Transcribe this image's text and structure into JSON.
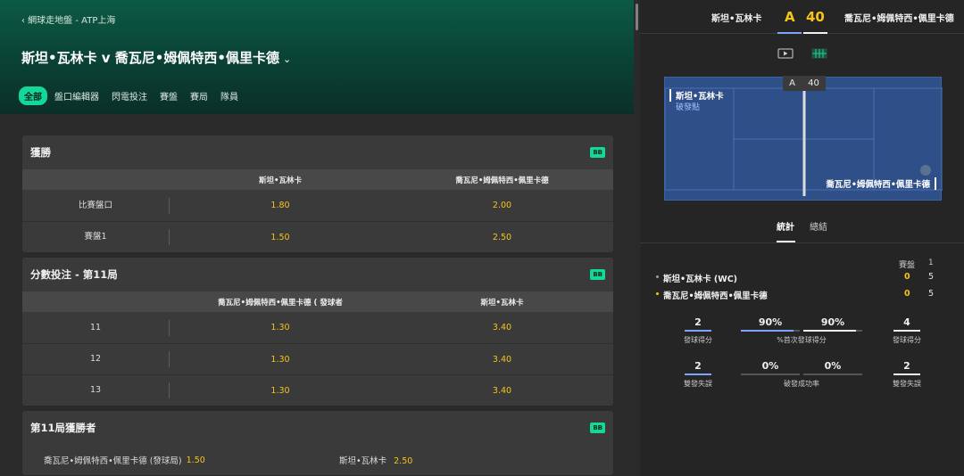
{
  "breadcrumb": "‹ 網球走地盤 - ATP上海",
  "match": {
    "title": "斯坦•瓦林卡 v 喬瓦尼•姆佩特西•佩里卡德",
    "chevron": "⌄"
  },
  "tabs": [
    "全部",
    "盤口編輯器",
    "閃電投注",
    "賽盤",
    "賽局",
    "隊員"
  ],
  "markets": {
    "win": {
      "title": "獲勝",
      "badge": "BB",
      "col1": "斯坦•瓦林卡",
      "col2": "喬瓦尼•姆佩特西•佩里卡德",
      "rows": [
        {
          "label": "比賽盤口",
          "o1": "1.80",
          "o2": "2.00"
        },
        {
          "label": "賽盤1",
          "o1": "1.50",
          "o2": "2.50"
        }
      ]
    },
    "points": {
      "title": "分數投注 - 第11局",
      "badge": "BB",
      "col1": "喬瓦尼•姆佩特西•佩里卡德 ( 發球者",
      "col2": "斯坦•瓦林卡",
      "rows": [
        {
          "label": "11",
          "o1": "1.30",
          "o2": "3.40"
        },
        {
          "label": "12",
          "o1": "1.30",
          "o2": "3.40"
        },
        {
          "label": "13",
          "o1": "1.30",
          "o2": "3.40"
        }
      ]
    },
    "game_winner": {
      "title": "第11局獲勝者",
      "badge": "BB",
      "p1": "喬瓦尼•姆佩特西•佩里卡德 (發球局)",
      "o1": "1.50",
      "p2": "斯坦•瓦林卡",
      "o2": "2.50"
    }
  },
  "scoreboard": {
    "p1": "斯坦•瓦林卡",
    "s1": "A",
    "s2": "40",
    "p2": "喬瓦尼•姆佩特西•佩里卡德"
  },
  "court": {
    "chip_a": "A",
    "chip_40": "40",
    "top_player": "斯坦•瓦林卡",
    "top_sub": "破發點",
    "bottom_player": "喬瓦尼•姆佩特西•佩里卡德"
  },
  "stats_tabs": {
    "active": "統計",
    "other": "總結"
  },
  "stats": {
    "set_header": "賽盤",
    "set_num": "1",
    "players": [
      {
        "name": "斯坦•瓦林卡 (WC)",
        "points": "0",
        "sets": "5",
        "dot_color": "#9aa0a8"
      },
      {
        "name": "喬瓦尼•姆佩特西•佩里卡德",
        "points": "0",
        "sets": "5",
        "dot_color": "#f5c518"
      }
    ],
    "aces_label": "發球得分",
    "aces_left": "2",
    "aces_right": "4",
    "first_serve_label": "%首次發球得分",
    "first_serve_left": "90%",
    "first_serve_right": "90%",
    "df_label": "雙發失誤",
    "df_left": "2",
    "df_right": "2",
    "bp_label": "破發成功率",
    "bp_left": "0%",
    "bp_right": "0%"
  },
  "colors": {
    "accent": "#14d79a",
    "odds": "#f5c518",
    "blue": "#7da6ff"
  }
}
